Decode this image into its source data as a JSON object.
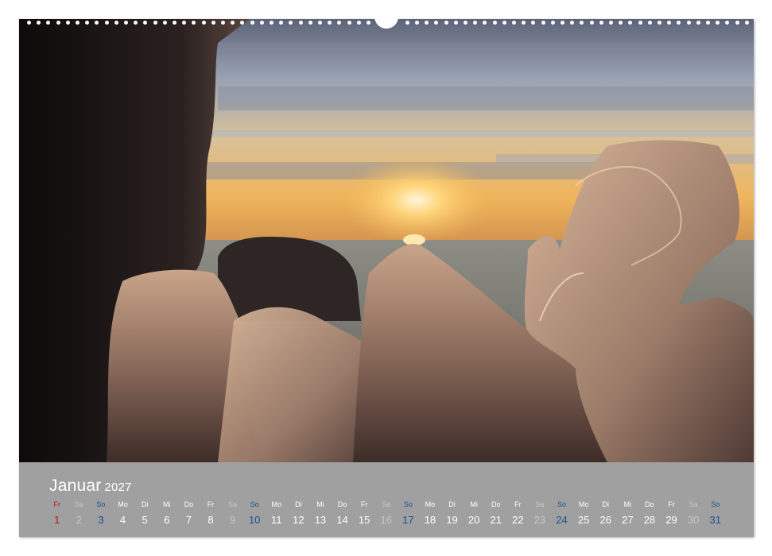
{
  "calendar": {
    "month": "Januar",
    "year": "2027",
    "colors": {
      "regular": "#ffffff",
      "saturday": "#c8c8c8",
      "sunday": "#1a4f8f",
      "holiday": "#c0151b",
      "strip": "#a0a0a0"
    },
    "days": [
      {
        "wd": "Fr",
        "d": "1",
        "t": "holiday"
      },
      {
        "wd": "Sa",
        "d": "2",
        "t": "sat"
      },
      {
        "wd": "So",
        "d": "3",
        "t": "sun"
      },
      {
        "wd": "Mo",
        "d": "4",
        "t": ""
      },
      {
        "wd": "Di",
        "d": "5",
        "t": ""
      },
      {
        "wd": "Mi",
        "d": "6",
        "t": ""
      },
      {
        "wd": "Do",
        "d": "7",
        "t": ""
      },
      {
        "wd": "Fr",
        "d": "8",
        "t": ""
      },
      {
        "wd": "Sa",
        "d": "9",
        "t": "sat"
      },
      {
        "wd": "So",
        "d": "10",
        "t": "sun"
      },
      {
        "wd": "Mo",
        "d": "11",
        "t": ""
      },
      {
        "wd": "Di",
        "d": "12",
        "t": ""
      },
      {
        "wd": "Mi",
        "d": "13",
        "t": ""
      },
      {
        "wd": "Do",
        "d": "14",
        "t": ""
      },
      {
        "wd": "Fr",
        "d": "15",
        "t": ""
      },
      {
        "wd": "Sa",
        "d": "16",
        "t": "sat"
      },
      {
        "wd": "So",
        "d": "17",
        "t": "sun"
      },
      {
        "wd": "Mo",
        "d": "18",
        "t": ""
      },
      {
        "wd": "Di",
        "d": "19",
        "t": ""
      },
      {
        "wd": "Mi",
        "d": "20",
        "t": ""
      },
      {
        "wd": "Do",
        "d": "21",
        "t": ""
      },
      {
        "wd": "Fr",
        "d": "22",
        "t": ""
      },
      {
        "wd": "Sa",
        "d": "23",
        "t": "sat"
      },
      {
        "wd": "So",
        "d": "24",
        "t": "sun"
      },
      {
        "wd": "Mo",
        "d": "25",
        "t": ""
      },
      {
        "wd": "Di",
        "d": "26",
        "t": ""
      },
      {
        "wd": "Mi",
        "d": "27",
        "t": ""
      },
      {
        "wd": "Do",
        "d": "28",
        "t": ""
      },
      {
        "wd": "Fr",
        "d": "29",
        "t": ""
      },
      {
        "wd": "Sa",
        "d": "30",
        "t": "sat"
      },
      {
        "wd": "So",
        "d": "31",
        "t": "sun"
      }
    ]
  }
}
